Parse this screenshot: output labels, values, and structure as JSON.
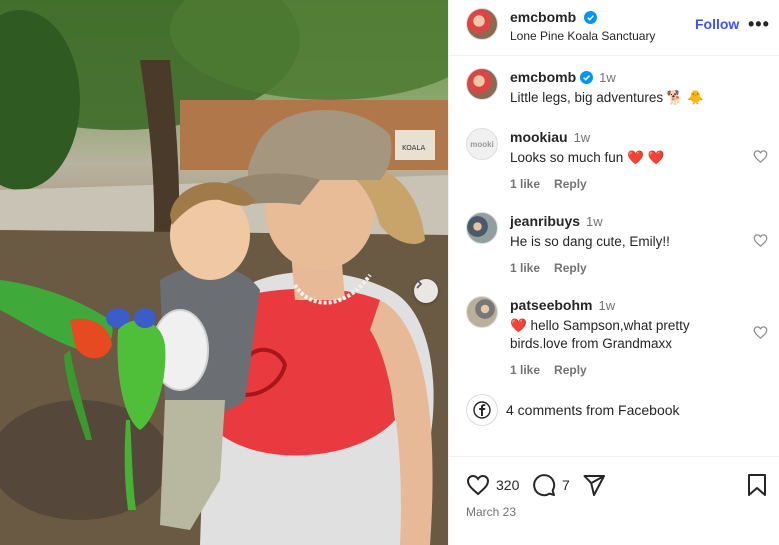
{
  "post": {
    "author": "emcbomb",
    "location": "Lone Pine Koala Sanctuary",
    "follow_label": "Follow",
    "more_label": "•••",
    "caption": {
      "username": "emcbomb",
      "time": "1w",
      "text": "Little legs, big adventures 🐕 🐥"
    },
    "photo_sign": "KOALA",
    "comments": [
      {
        "username": "mookiau",
        "time": "1w",
        "text": "Looks so much fun ❤️ ❤️",
        "likes": "1 like",
        "reply": "Reply",
        "avatar_text": "mooki"
      },
      {
        "username": "jeanribuys",
        "time": "1w",
        "text": "He is so dang cute, Emily!!",
        "likes": "1 like",
        "reply": "Reply"
      },
      {
        "username": "patseebohm",
        "time": "1w",
        "text": "❤️ hello Sampson,what pretty birds.love from Grandmaxx",
        "likes": "1 like",
        "reply": "Reply"
      }
    ],
    "facebook_comments": "4 comments from Facebook",
    "likes_count": "320",
    "comments_count": "7",
    "date": "March 23"
  },
  "colors": {
    "accent": "#4150f7",
    "verified": "#0095f6",
    "text": "#262626",
    "secondary": "#737373"
  }
}
